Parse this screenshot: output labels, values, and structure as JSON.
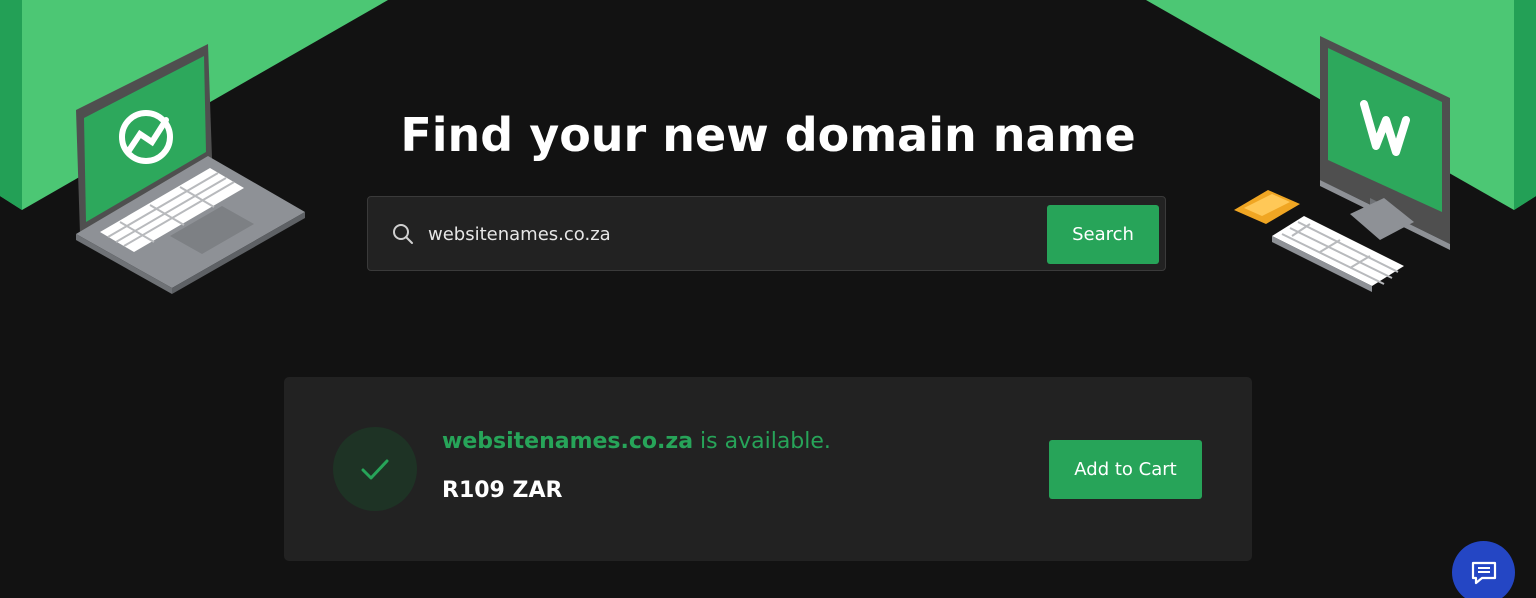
{
  "page": {
    "title": "Find your new domain name"
  },
  "search": {
    "value": "websitenames.co.za",
    "button_label": "Search",
    "icon": "search-icon"
  },
  "result": {
    "domain": "websitenames.co.za",
    "status_text": " is available.",
    "price": "R109 ZAR",
    "cart_label": "Add to Cart",
    "status_icon": "check-icon"
  },
  "chat": {
    "icon": "chat-icon"
  },
  "illustrations": {
    "left": "laptop-illustration",
    "right": "desktop-computer-illustration",
    "left_logo": "globe-logo-icon",
    "right_logo": "w-logo-icon"
  },
  "colors": {
    "background": "#121212",
    "accent_green": "#27a459",
    "light_green": "#4cc774",
    "card": "#222222",
    "chat_blue": "#2446c4"
  }
}
